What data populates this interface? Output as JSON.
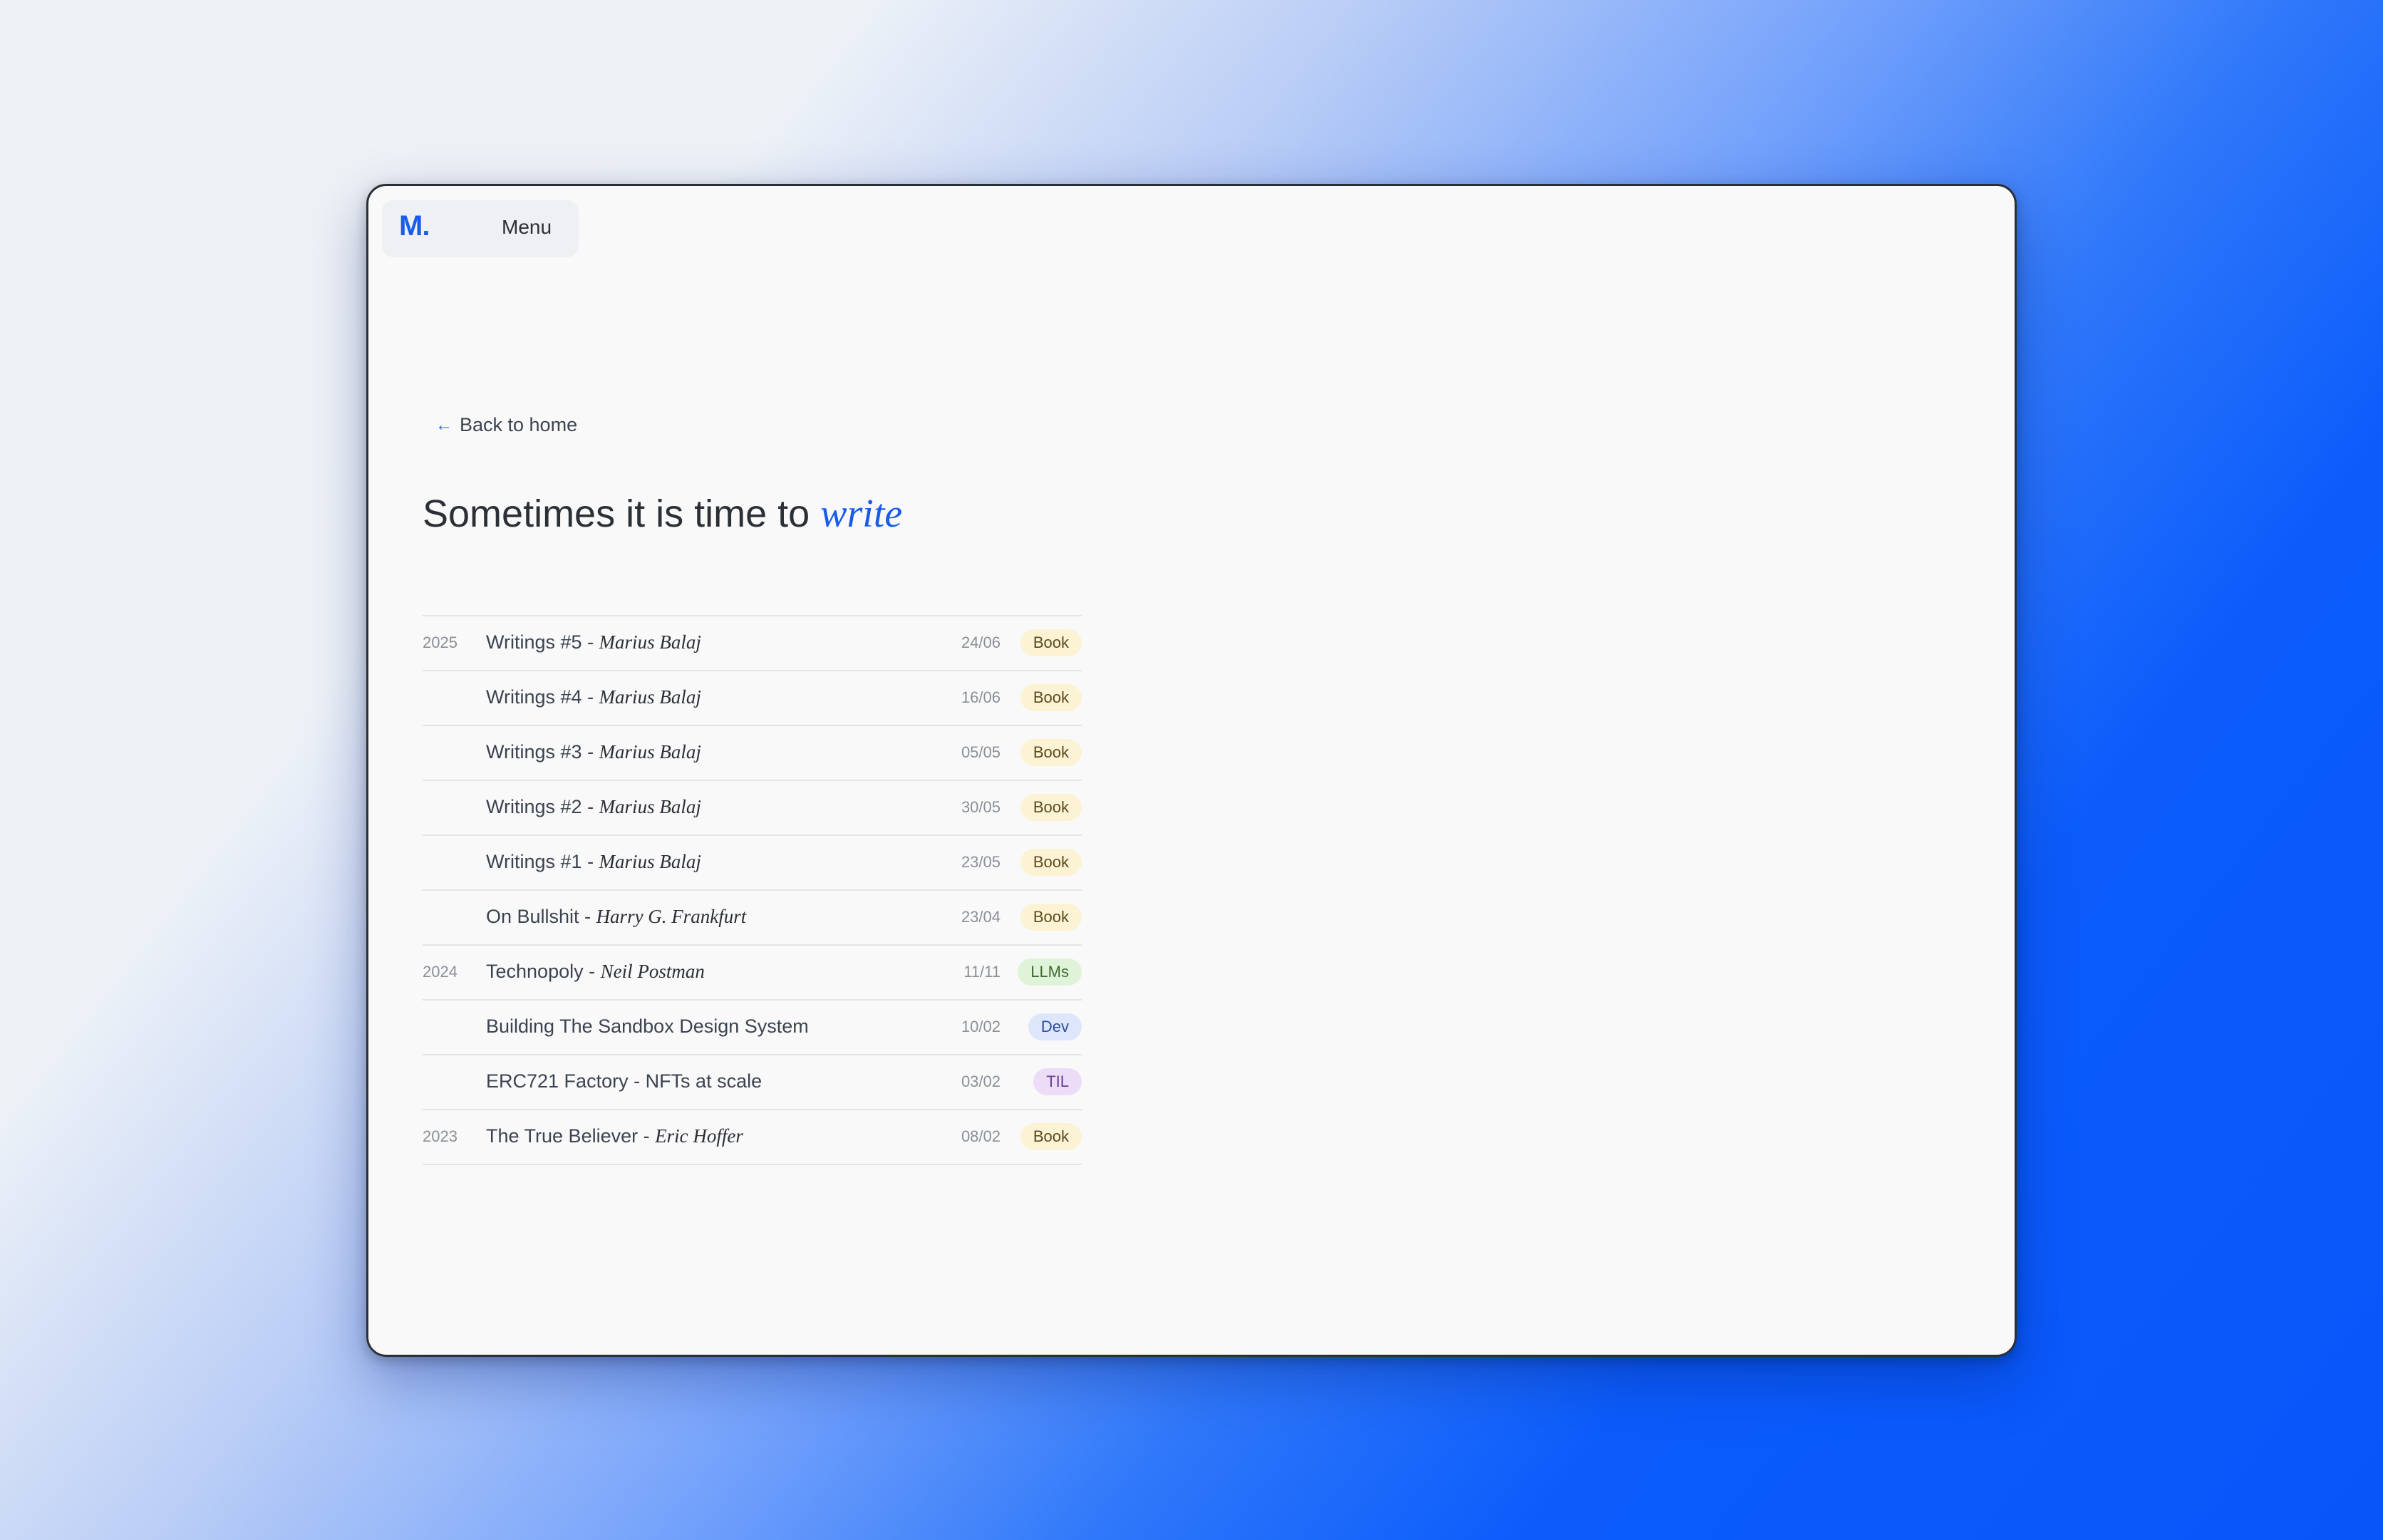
{
  "nav": {
    "logo": "M.",
    "menu_label": "Menu"
  },
  "back_link": {
    "arrow": "←",
    "label": "Back to home"
  },
  "title": {
    "prefix": "Sometimes it is time to ",
    "accent": "write"
  },
  "colors": {
    "accent": "#1a5ce8",
    "tag_book": "#fbf3d4",
    "tag_llms": "#dff3d9",
    "tag_dev": "#dde6fb",
    "tag_til": "#ecdcf8"
  },
  "posts": [
    {
      "year": "2025",
      "title": "Writings #5",
      "author": "Marius Balaj",
      "date": "24/06",
      "tag": "Book"
    },
    {
      "year": "",
      "title": "Writings #4",
      "author": "Marius Balaj",
      "date": "16/06",
      "tag": "Book"
    },
    {
      "year": "",
      "title": "Writings #3",
      "author": "Marius Balaj",
      "date": "05/05",
      "tag": "Book"
    },
    {
      "year": "",
      "title": "Writings #2",
      "author": "Marius Balaj",
      "date": "30/05",
      "tag": "Book"
    },
    {
      "year": "",
      "title": "Writings #1",
      "author": "Marius Balaj",
      "date": "23/05",
      "tag": "Book"
    },
    {
      "year": "",
      "title": "On Bullshit",
      "author": "Harry G. Frankfurt",
      "date": "23/04",
      "tag": "Book"
    },
    {
      "year": "2024",
      "title": "Technopoly",
      "author": "Neil Postman",
      "date": "11/11",
      "tag": "LLMs"
    },
    {
      "year": "",
      "title": "Building The Sandbox Design System",
      "author": "",
      "date": "10/02",
      "tag": "Dev"
    },
    {
      "year": "",
      "title": "ERC721 Factory - NFTs at scale",
      "author": "",
      "date": "03/02",
      "tag": "TIL"
    },
    {
      "year": "2023",
      "title": "The True Believer",
      "author": "Eric Hoffer",
      "date": "08/02",
      "tag": "Book"
    }
  ]
}
